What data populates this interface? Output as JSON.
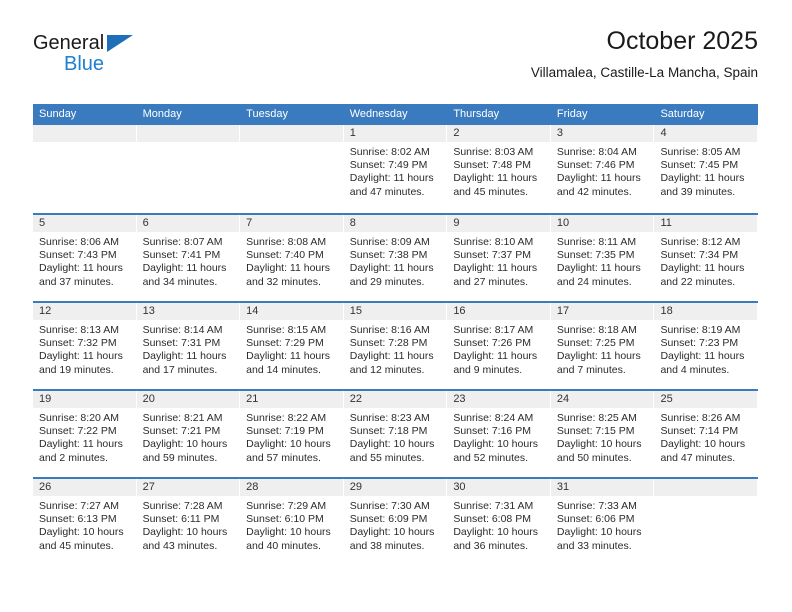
{
  "brand": {
    "name_top": "General",
    "name_bottom": "Blue",
    "triangle_color": "#1f6fb8",
    "blue_text_color": "#1f7fd0"
  },
  "header": {
    "title": "October 2025",
    "subtitle": "Villamalea, Castille-La Mancha, Spain",
    "header_bg": "#3a7bbf",
    "daynum_bg": "#efefef"
  },
  "weekday_names": [
    "Sunday",
    "Monday",
    "Tuesday",
    "Wednesday",
    "Thursday",
    "Friday",
    "Saturday"
  ],
  "weeks": [
    [
      {
        "day": "",
        "sunrise": "",
        "sunset": "",
        "daylight_1": "",
        "daylight_2": ""
      },
      {
        "day": "",
        "sunrise": "",
        "sunset": "",
        "daylight_1": "",
        "daylight_2": ""
      },
      {
        "day": "",
        "sunrise": "",
        "sunset": "",
        "daylight_1": "",
        "daylight_2": ""
      },
      {
        "day": "1",
        "sunrise": "Sunrise: 8:02 AM",
        "sunset": "Sunset: 7:49 PM",
        "daylight_1": "Daylight: 11 hours",
        "daylight_2": "and 47 minutes."
      },
      {
        "day": "2",
        "sunrise": "Sunrise: 8:03 AM",
        "sunset": "Sunset: 7:48 PM",
        "daylight_1": "Daylight: 11 hours",
        "daylight_2": "and 45 minutes."
      },
      {
        "day": "3",
        "sunrise": "Sunrise: 8:04 AM",
        "sunset": "Sunset: 7:46 PM",
        "daylight_1": "Daylight: 11 hours",
        "daylight_2": "and 42 minutes."
      },
      {
        "day": "4",
        "sunrise": "Sunrise: 8:05 AM",
        "sunset": "Sunset: 7:45 PM",
        "daylight_1": "Daylight: 11 hours",
        "daylight_2": "and 39 minutes."
      }
    ],
    [
      {
        "day": "5",
        "sunrise": "Sunrise: 8:06 AM",
        "sunset": "Sunset: 7:43 PM",
        "daylight_1": "Daylight: 11 hours",
        "daylight_2": "and 37 minutes."
      },
      {
        "day": "6",
        "sunrise": "Sunrise: 8:07 AM",
        "sunset": "Sunset: 7:41 PM",
        "daylight_1": "Daylight: 11 hours",
        "daylight_2": "and 34 minutes."
      },
      {
        "day": "7",
        "sunrise": "Sunrise: 8:08 AM",
        "sunset": "Sunset: 7:40 PM",
        "daylight_1": "Daylight: 11 hours",
        "daylight_2": "and 32 minutes."
      },
      {
        "day": "8",
        "sunrise": "Sunrise: 8:09 AM",
        "sunset": "Sunset: 7:38 PM",
        "daylight_1": "Daylight: 11 hours",
        "daylight_2": "and 29 minutes."
      },
      {
        "day": "9",
        "sunrise": "Sunrise: 8:10 AM",
        "sunset": "Sunset: 7:37 PM",
        "daylight_1": "Daylight: 11 hours",
        "daylight_2": "and 27 minutes."
      },
      {
        "day": "10",
        "sunrise": "Sunrise: 8:11 AM",
        "sunset": "Sunset: 7:35 PM",
        "daylight_1": "Daylight: 11 hours",
        "daylight_2": "and 24 minutes."
      },
      {
        "day": "11",
        "sunrise": "Sunrise: 8:12 AM",
        "sunset": "Sunset: 7:34 PM",
        "daylight_1": "Daylight: 11 hours",
        "daylight_2": "and 22 minutes."
      }
    ],
    [
      {
        "day": "12",
        "sunrise": "Sunrise: 8:13 AM",
        "sunset": "Sunset: 7:32 PM",
        "daylight_1": "Daylight: 11 hours",
        "daylight_2": "and 19 minutes."
      },
      {
        "day": "13",
        "sunrise": "Sunrise: 8:14 AM",
        "sunset": "Sunset: 7:31 PM",
        "daylight_1": "Daylight: 11 hours",
        "daylight_2": "and 17 minutes."
      },
      {
        "day": "14",
        "sunrise": "Sunrise: 8:15 AM",
        "sunset": "Sunset: 7:29 PM",
        "daylight_1": "Daylight: 11 hours",
        "daylight_2": "and 14 minutes."
      },
      {
        "day": "15",
        "sunrise": "Sunrise: 8:16 AM",
        "sunset": "Sunset: 7:28 PM",
        "daylight_1": "Daylight: 11 hours",
        "daylight_2": "and 12 minutes."
      },
      {
        "day": "16",
        "sunrise": "Sunrise: 8:17 AM",
        "sunset": "Sunset: 7:26 PM",
        "daylight_1": "Daylight: 11 hours",
        "daylight_2": "and 9 minutes."
      },
      {
        "day": "17",
        "sunrise": "Sunrise: 8:18 AM",
        "sunset": "Sunset: 7:25 PM",
        "daylight_1": "Daylight: 11 hours",
        "daylight_2": "and 7 minutes."
      },
      {
        "day": "18",
        "sunrise": "Sunrise: 8:19 AM",
        "sunset": "Sunset: 7:23 PM",
        "daylight_1": "Daylight: 11 hours",
        "daylight_2": "and 4 minutes."
      }
    ],
    [
      {
        "day": "19",
        "sunrise": "Sunrise: 8:20 AM",
        "sunset": "Sunset: 7:22 PM",
        "daylight_1": "Daylight: 11 hours",
        "daylight_2": "and 2 minutes."
      },
      {
        "day": "20",
        "sunrise": "Sunrise: 8:21 AM",
        "sunset": "Sunset: 7:21 PM",
        "daylight_1": "Daylight: 10 hours",
        "daylight_2": "and 59 minutes."
      },
      {
        "day": "21",
        "sunrise": "Sunrise: 8:22 AM",
        "sunset": "Sunset: 7:19 PM",
        "daylight_1": "Daylight: 10 hours",
        "daylight_2": "and 57 minutes."
      },
      {
        "day": "22",
        "sunrise": "Sunrise: 8:23 AM",
        "sunset": "Sunset: 7:18 PM",
        "daylight_1": "Daylight: 10 hours",
        "daylight_2": "and 55 minutes."
      },
      {
        "day": "23",
        "sunrise": "Sunrise: 8:24 AM",
        "sunset": "Sunset: 7:16 PM",
        "daylight_1": "Daylight: 10 hours",
        "daylight_2": "and 52 minutes."
      },
      {
        "day": "24",
        "sunrise": "Sunrise: 8:25 AM",
        "sunset": "Sunset: 7:15 PM",
        "daylight_1": "Daylight: 10 hours",
        "daylight_2": "and 50 minutes."
      },
      {
        "day": "25",
        "sunrise": "Sunrise: 8:26 AM",
        "sunset": "Sunset: 7:14 PM",
        "daylight_1": "Daylight: 10 hours",
        "daylight_2": "and 47 minutes."
      }
    ],
    [
      {
        "day": "26",
        "sunrise": "Sunrise: 7:27 AM",
        "sunset": "Sunset: 6:13 PM",
        "daylight_1": "Daylight: 10 hours",
        "daylight_2": "and 45 minutes."
      },
      {
        "day": "27",
        "sunrise": "Sunrise: 7:28 AM",
        "sunset": "Sunset: 6:11 PM",
        "daylight_1": "Daylight: 10 hours",
        "daylight_2": "and 43 minutes."
      },
      {
        "day": "28",
        "sunrise": "Sunrise: 7:29 AM",
        "sunset": "Sunset: 6:10 PM",
        "daylight_1": "Daylight: 10 hours",
        "daylight_2": "and 40 minutes."
      },
      {
        "day": "29",
        "sunrise": "Sunrise: 7:30 AM",
        "sunset": "Sunset: 6:09 PM",
        "daylight_1": "Daylight: 10 hours",
        "daylight_2": "and 38 minutes."
      },
      {
        "day": "30",
        "sunrise": "Sunrise: 7:31 AM",
        "sunset": "Sunset: 6:08 PM",
        "daylight_1": "Daylight: 10 hours",
        "daylight_2": "and 36 minutes."
      },
      {
        "day": "31",
        "sunrise": "Sunrise: 7:33 AM",
        "sunset": "Sunset: 6:06 PM",
        "daylight_1": "Daylight: 10 hours",
        "daylight_2": "and 33 minutes."
      },
      {
        "day": "",
        "sunrise": "",
        "sunset": "",
        "daylight_1": "",
        "daylight_2": ""
      }
    ]
  ]
}
